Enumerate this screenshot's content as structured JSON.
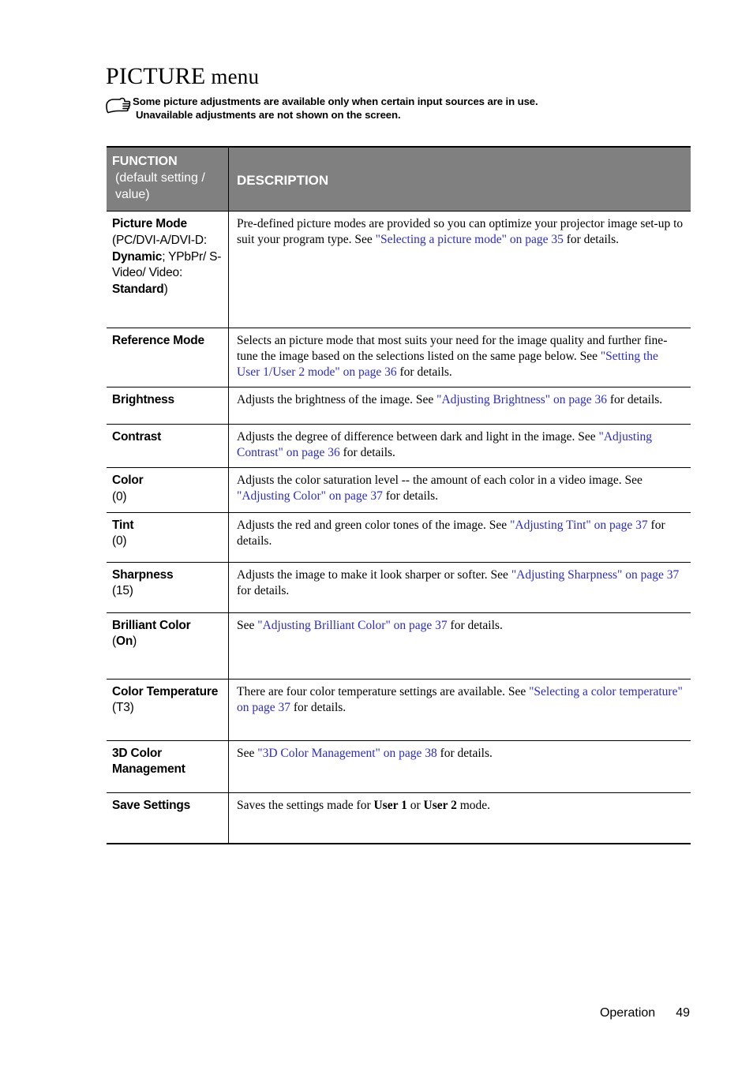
{
  "page": {
    "title_primary": "PICTURE",
    "title_secondary": "menu",
    "note_icon": "pointing-hand-icon",
    "note_line1": "Some picture adjustments are available only when certain input sources are in use.",
    "note_line2": "Unavailable adjustments are not shown on the screen.",
    "footer_label": "Operation",
    "footer_page": "49",
    "header_bg_color": "#808080",
    "link_color": "#2b2bcc"
  },
  "table": {
    "header": {
      "function_title": "FUNCTION",
      "function_subtitle": "(default setting / value)",
      "description_title": "DESCRIPTION"
    },
    "rows": [
      {
        "name": "Picture Mode",
        "default": "(PC/DVI-A/DVI-D: Dynamic; YPbPr/ S-Video/ Video: Standard)",
        "default_parts": [
          {
            "text": "(PC/DVI-A/DVI-",
            "bold": false
          },
          {
            "text": "D: ",
            "bold": false
          },
          {
            "text": "Dynamic",
            "bold": true
          },
          {
            "text": "; YPbPr/ S-Video/ Video: ",
            "bold": false
          },
          {
            "text": "Standard",
            "bold": true
          },
          {
            "text": ")",
            "bold": false
          }
        ],
        "description": "Pre-defined picture modes are provided so you can optimize your projector image set-up to suit your program type. See \"Selecting a picture mode\" on page 35 for details.",
        "description_parts": [
          {
            "text": "Pre-defined picture modes are provided so you can optimize your projector image set-up to suit your program type. See ",
            "link": false
          },
          {
            "text": "\"Selecting a picture mode\" on page 35",
            "link": true
          },
          {
            "text": " for details.",
            "link": false
          }
        ]
      },
      {
        "name": "Reference Mode",
        "default": "",
        "description": "Selects an picture mode that most suits your need for the image quality and further fine-tune the image based on the selections listed on the same page below. See \"Setting the User 1/User 2 mode\" on page 36 for details.",
        "description_parts": [
          {
            "text": "Selects an picture mode that most suits your need for the image quality and further fine-tune the image based on the selections listed on the same page below. See ",
            "link": false
          },
          {
            "text": "\"Setting the User 1/User 2 mode\" on page 36",
            "link": true
          },
          {
            "text": " for details.",
            "link": false
          }
        ]
      },
      {
        "name": "Brightness",
        "default": "",
        "description": "Adjusts the brightness of the image. See \"Adjusting Brightness\" on page 36 for details.",
        "description_parts": [
          {
            "text": "Adjusts the brightness of the image. See ",
            "link": false
          },
          {
            "text": "\"Adjusting Brightness\" on page 36",
            "link": true
          },
          {
            "text": " for details.",
            "link": false
          }
        ]
      },
      {
        "name": "Contrast",
        "default": "",
        "description": "Adjusts the degree of difference between dark and light in the image. See \"Adjusting Contrast\" on page 36 for details.",
        "description_parts": [
          {
            "text": "Adjusts the degree of difference between dark and light in the image. See ",
            "link": false
          },
          {
            "text": "\"Adjusting Contrast\" on page 36",
            "link": true
          },
          {
            "text": " for details.",
            "link": false
          }
        ]
      },
      {
        "name": "Color",
        "default": "(0)",
        "description": "Adjusts the color saturation level -- the amount of each color in a video image. See \"Adjusting Color\" on page 37 for details.",
        "description_parts": [
          {
            "text": "Adjusts the color saturation level -- the amount of each color in a video image. See ",
            "link": false
          },
          {
            "text": "\"Adjusting Color\" on page 37",
            "link": true
          },
          {
            "text": " for details.",
            "link": false
          }
        ]
      },
      {
        "name": "Tint",
        "default": "(0)",
        "description": "Adjusts the red and green color tones of the image. See \"Adjusting Tint\" on page 37 for details.",
        "description_parts": [
          {
            "text": "Adjusts the red and green color tones of the image. See ",
            "link": false
          },
          {
            "text": "\"Adjusting Tint\" on page 37",
            "link": true
          },
          {
            "text": " for details.",
            "link": false
          }
        ]
      },
      {
        "name": "Sharpness",
        "default": "(15)",
        "description": "Adjusts the image to make it look sharper or softer. See \"Adjusting Sharpness\" on page 37 for details.",
        "description_parts": [
          {
            "text": "Adjusts the image to make it look sharper or softer. See ",
            "link": false
          },
          {
            "text": "\"Adjusting Sharpness\" on page 37",
            "link": true
          },
          {
            "text": " for details.",
            "link": false
          }
        ]
      },
      {
        "name": "Brilliant Color",
        "default": "(On)",
        "default_parts": [
          {
            "text": "(",
            "bold": false
          },
          {
            "text": "On",
            "bold": true
          },
          {
            "text": ")",
            "bold": false
          }
        ],
        "description": "See \"Adjusting Brilliant Color\" on page 37 for details.",
        "description_parts": [
          {
            "text": "See ",
            "link": false
          },
          {
            "text": "\"Adjusting Brilliant Color\" on page 37",
            "link": true
          },
          {
            "text": " for details.",
            "link": false
          }
        ]
      },
      {
        "name": "Color Temperature",
        "default": "(T3)",
        "description": "There are four color temperature settings are available. See \"Selecting a color temperature\" on page 37 for details.",
        "description_parts": [
          {
            "text": "There are four color temperature settings are available. See ",
            "link": false
          },
          {
            "text": "\"Selecting a color temperature\" on page 37",
            "link": true
          },
          {
            "text": " for details.",
            "link": false
          }
        ]
      },
      {
        "name": "3D Color Management",
        "default": "",
        "description": "See \"3D Color Management\" on page 38 for details.",
        "description_parts": [
          {
            "text": "See ",
            "link": false
          },
          {
            "text": "\"3D Color Management\" on page 38",
            "link": true
          },
          {
            "text": " for details.",
            "link": false
          }
        ]
      },
      {
        "name": "Save Settings",
        "default": "",
        "description": "Saves the settings made for User 1 or User 2 mode.",
        "description_parts": [
          {
            "text": "Saves the settings made for ",
            "bold": false
          },
          {
            "text": "User 1",
            "bold": true
          },
          {
            "text": " or ",
            "bold": false
          },
          {
            "text": "User 2",
            "bold": true
          },
          {
            "text": " mode.",
            "bold": false
          }
        ]
      }
    ]
  }
}
